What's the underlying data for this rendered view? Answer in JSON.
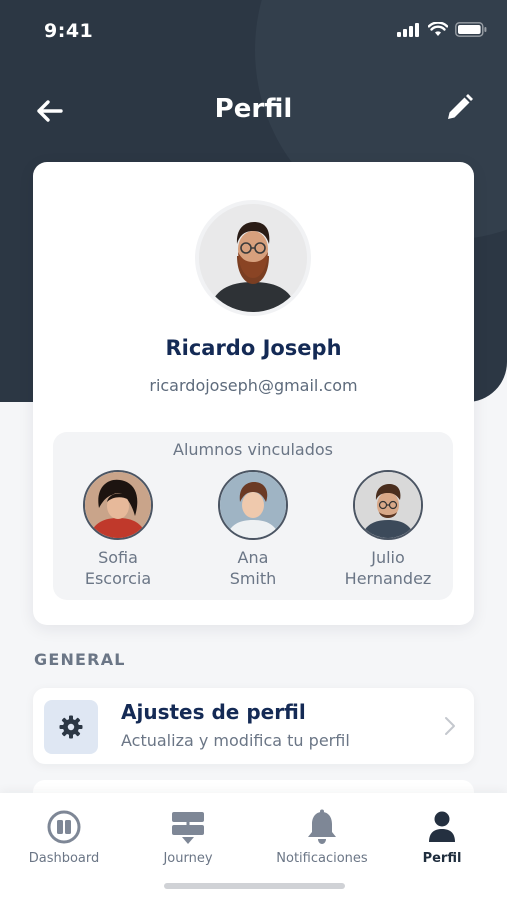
{
  "status_bar": {
    "time": "9:41"
  },
  "nav": {
    "title": "Perfil",
    "back_icon": "arrow-left-icon",
    "edit_icon": "pencil-icon"
  },
  "profile": {
    "name": "Ricardo Joseph",
    "email": "ricardojoseph@gmail.com"
  },
  "linked_students": {
    "title": "Alumnos vinculados",
    "students": [
      {
        "name": "Sofia\nEscorcia"
      },
      {
        "name": "Ana\nSmith"
      },
      {
        "name": "Julio\nHernandez"
      }
    ]
  },
  "general": {
    "label": "GENERAL",
    "items": [
      {
        "title": "Ajustes de perfil",
        "subtitle": "Actualiza y modifica tu perfil",
        "icon": "gear-icon"
      }
    ]
  },
  "tab_bar": {
    "tabs": [
      {
        "label": "Dashboard",
        "icon": "book-icon"
      },
      {
        "label": "Journey",
        "icon": "signpost-icon"
      },
      {
        "label": "Notificaciones",
        "icon": "bell-icon"
      },
      {
        "label": "Perfil",
        "icon": "user-icon",
        "active": true
      }
    ]
  },
  "colors": {
    "header": "#2c3744",
    "primary_text": "#142a55",
    "secondary_text": "#6b7686",
    "icon_box": "#dfe7f3"
  }
}
